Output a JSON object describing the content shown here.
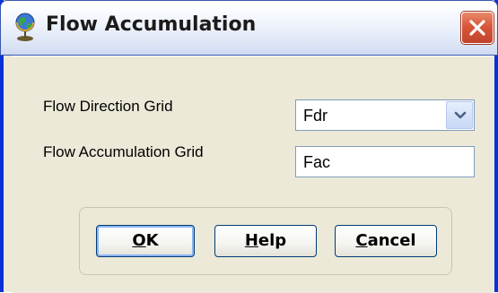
{
  "window": {
    "title": "Flow Accumulation",
    "icon": "globe-icon",
    "close_icon": "close-icon"
  },
  "form": {
    "flow_direction": {
      "label": "Flow Direction Grid",
      "value": "Fdr"
    },
    "flow_accumulation": {
      "label": "Flow Accumulation Grid",
      "value": "Fac"
    }
  },
  "buttons": {
    "ok": {
      "mnemonic": "O",
      "rest": "K"
    },
    "help": {
      "mnemonic": "H",
      "rest": "elp"
    },
    "cancel": {
      "mnemonic": "C",
      "rest": "ancel"
    }
  },
  "colors": {
    "window_face": "#ece9d8",
    "frame_blue": "#0831d9",
    "close_red": "#d9573a",
    "field_border": "#7f9db9"
  }
}
